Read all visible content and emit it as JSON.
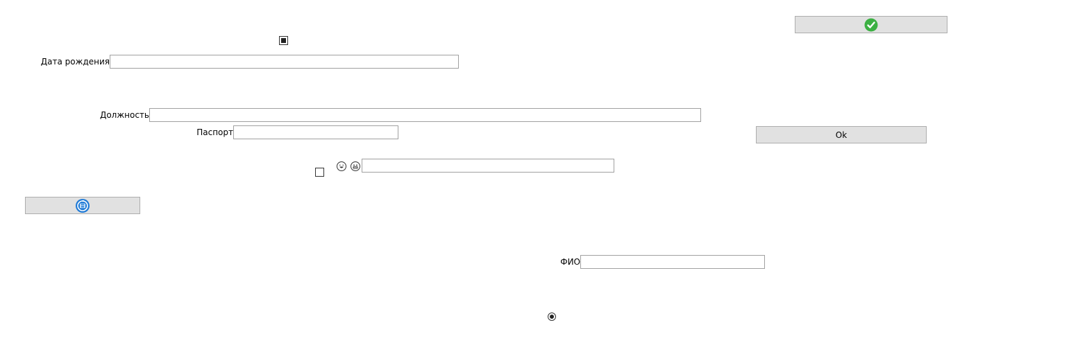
{
  "buttons": {
    "confirm_icon": "check-circle-green",
    "ok_label": "Ok",
    "refresh_icon": "refresh-save-blue"
  },
  "labels": {
    "birth_date": "Дата рождения",
    "position": "Должность",
    "passport": "Паспорт",
    "full_name": "ФИО"
  },
  "fields": {
    "birth_date_value": "",
    "position_value": "",
    "passport_value": "",
    "emoji_field_value": "",
    "full_name_value": ""
  },
  "states": {
    "top_checkbox": "indeterminate",
    "mid_checkbox": "unchecked",
    "radio": "selected"
  },
  "colors": {
    "button_bg": "#e1e1e1",
    "button_border": "#adadad",
    "field_border": "#a0a0a0",
    "check_green": "#3cb043",
    "refresh_blue": "#1f7ad6"
  }
}
